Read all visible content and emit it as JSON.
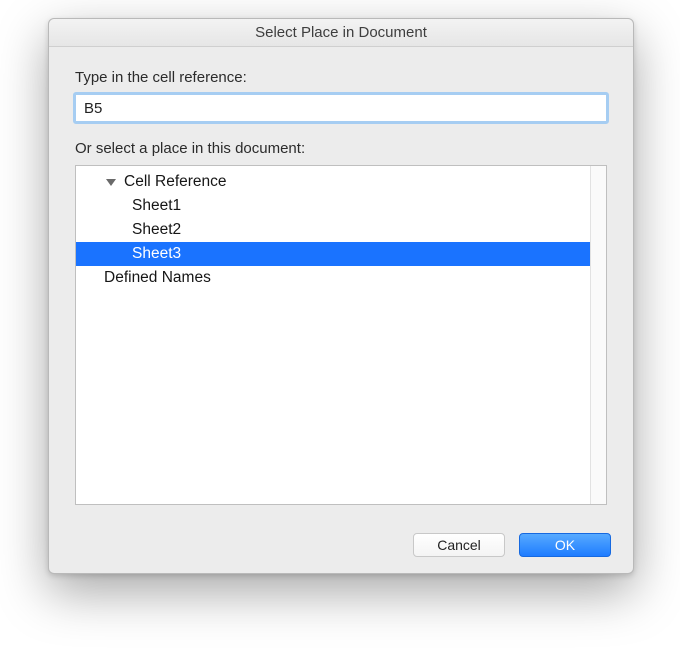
{
  "dialog": {
    "title": "Select Place in Document",
    "cellref_label": "Type in the cell reference:",
    "cellref_value": "B5",
    "place_label": "Or select a place in this document:",
    "tree": {
      "groups": [
        {
          "label": "Cell Reference",
          "expanded": true,
          "children": [
            {
              "label": "Sheet1",
              "selected": false
            },
            {
              "label": "Sheet2",
              "selected": false
            },
            {
              "label": "Sheet3",
              "selected": true
            }
          ]
        },
        {
          "label": "Defined Names",
          "expanded": false,
          "children": []
        }
      ]
    },
    "buttons": {
      "cancel": "Cancel",
      "ok": "OK"
    }
  }
}
